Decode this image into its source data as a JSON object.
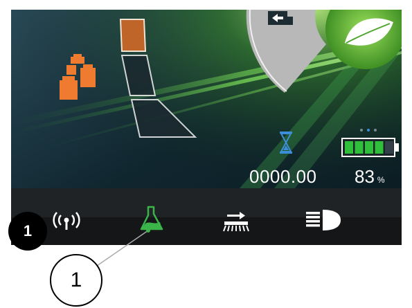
{
  "status": {
    "timer_value": "0000.00",
    "battery_value": "83",
    "battery_unit": "%",
    "battery_level_fraction": 0.83
  },
  "annotations": {
    "badge_number": "1",
    "callout_number": "1"
  },
  "icons": {
    "weights": "weights-icon",
    "gear_selector": "gear-level-selector",
    "truck_return": "truck-return-icon",
    "eco_leaf": "eco-leaf-icon",
    "hourglass": "hourglass-icon",
    "battery": "battery-icon",
    "radio": "radio-signal-icon",
    "flask": "flask-icon",
    "sweeper": "sweeper-icon",
    "headlight": "headlight-icon"
  },
  "colors": {
    "accent_green": "#3bb54a",
    "eco_green": "#4fa52d",
    "gear_active": "#c0652a",
    "weights_orange": "#ee7b30",
    "battery_green": "#2fbf3a",
    "hourglass_blue": "#3c8fd6"
  }
}
